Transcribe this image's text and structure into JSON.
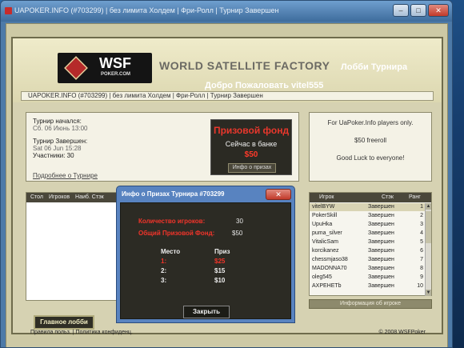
{
  "os_window": {
    "title": "UAPOKER.INFO (#703299)  |  без лимита Холдем  |  Фри-Ролл  |  Турнир Завершен",
    "buttons": {
      "minimize": "–",
      "maximize": "□",
      "close": "✕"
    }
  },
  "header": {
    "logo_text": "WSF",
    "logo_sub": "POKER.COM",
    "brand": "WORLD SATELLITE FACTORY",
    "lobby_title": "Лобби Турнира",
    "welcome": "Добро Пожаловать vitel555",
    "breadcrumb": "UAPOKER.INFO (#703299)  |  без лимита Холдем  |  Фри-Ролл  |  Турнир Завершен"
  },
  "tournament": {
    "started_label": "Турнир начался:",
    "started_value": "Сб. 06 Июнь 13:00",
    "finished_label": "Турнир Завершен:",
    "finished_value": "Sat 06 Jun 15:28",
    "participants": "Участники: 30",
    "details_link": "Подробнее о Турнире"
  },
  "prize_pool": {
    "title": "Призовой фонд",
    "bank_label": "Сейчас в банке",
    "amount": "$50",
    "info_button": "Инфо о призах"
  },
  "notice": {
    "line1": "For UaPoker.Info players only.",
    "line2": "$50 freeroll",
    "line3": "Good Luck to everyone!"
  },
  "tables": {
    "headers": [
      "Стол",
      "Игроков",
      "Наиб. Стэк"
    ]
  },
  "players": {
    "headers": {
      "name": "Игрок",
      "stack": "Стэк",
      "rank": "Ранг"
    },
    "rows": [
      {
        "name": "vitelBYW",
        "stack": "Завершен",
        "rank": "1"
      },
      {
        "name": "PokerSkill",
        "stack": "Завершен",
        "rank": "2"
      },
      {
        "name": "UpuHka",
        "stack": "Завершен",
        "rank": "3"
      },
      {
        "name": "puma_silver",
        "stack": "Завершен",
        "rank": "4"
      },
      {
        "name": "VitalicSam",
        "stack": "Завершен",
        "rank": "5"
      },
      {
        "name": "korcikanez",
        "stack": "Завершен",
        "rank": "6"
      },
      {
        "name": "chessmjaso38",
        "stack": "Завершен",
        "rank": "7"
      },
      {
        "name": "MADONNA70",
        "stack": "Завершен",
        "rank": "8"
      },
      {
        "name": "oleg545",
        "stack": "Завершен",
        "rank": "9"
      },
      {
        "name": "AXPEHETb",
        "stack": "Завершен",
        "rank": "10"
      }
    ],
    "info_button": "Информация об игроке"
  },
  "main_lobby_button": "Главное лобби",
  "footer": {
    "left": "Правила польз.  |  Политика конфиденц.",
    "right": "© 2008 WSFPoker"
  },
  "modal": {
    "title": "Инфо о Призах Турнира #703299",
    "close_glyph": "✕",
    "players_label": "Количество игроков:",
    "players_value": "30",
    "pool_label": "Общий Призовой Фонд:",
    "pool_value": "$50",
    "col_place": "Место",
    "col_prize": "Приз",
    "prizes": [
      {
        "place": "1:",
        "prize": "$25"
      },
      {
        "place": "2:",
        "prize": "$15"
      },
      {
        "place": "3:",
        "prize": "$10"
      }
    ],
    "close_button": "Закрыть"
  },
  "colors": {
    "accent_red": "#e8372c",
    "panel_dark": "#2c2b24",
    "frame_olive": "#d6d2b2",
    "modal_blue": "#5883c0"
  }
}
